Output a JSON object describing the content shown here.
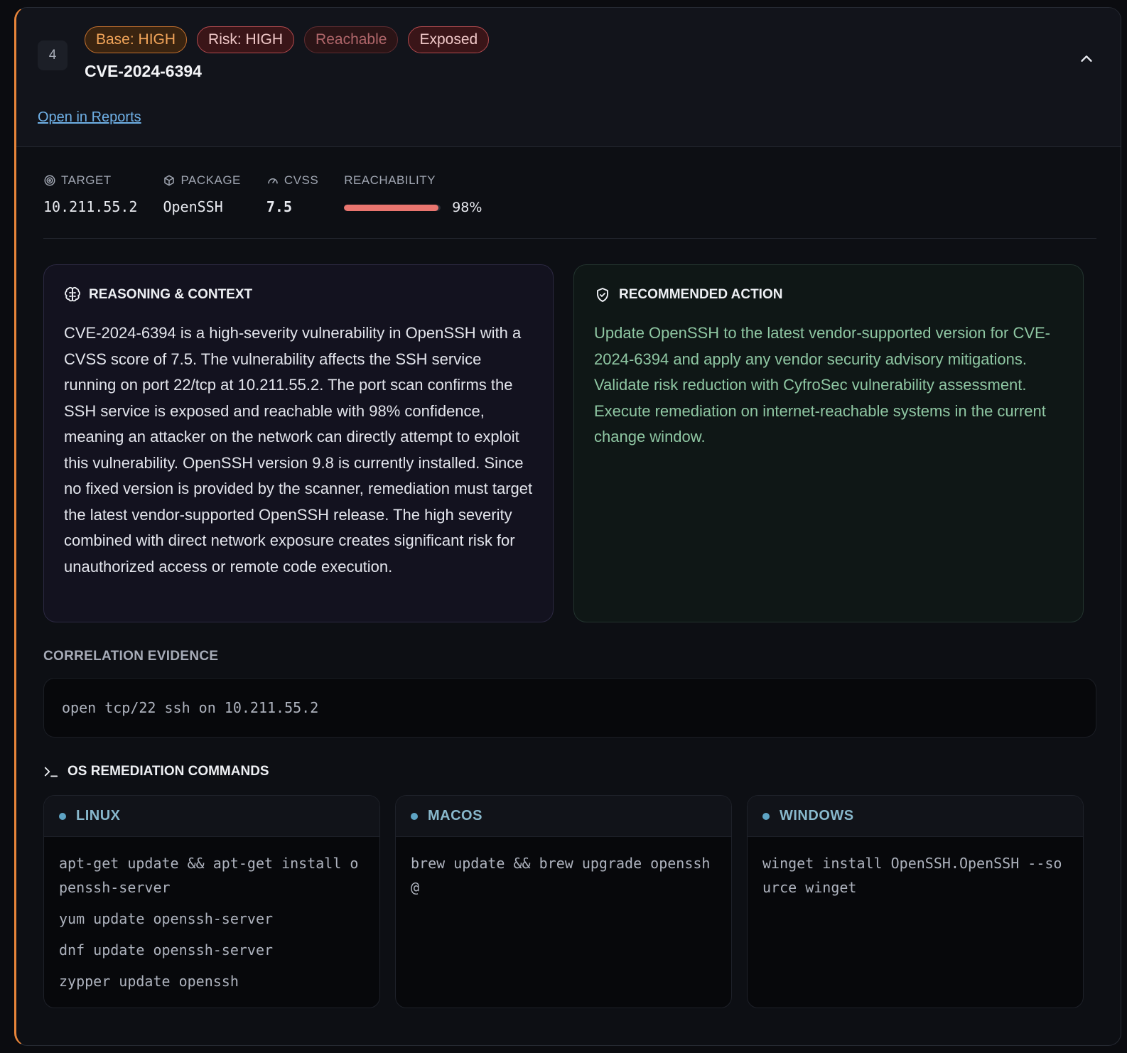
{
  "finding": {
    "index": "4",
    "badges": {
      "base": "Base: HIGH",
      "risk": "Risk: HIGH",
      "reachable": "Reachable",
      "exposed": "Exposed"
    },
    "cve_id": "CVE-2024-6394",
    "open_link": "Open in Reports",
    "accent_color": "#e8853a"
  },
  "meta": {
    "target_label": "TARGET",
    "target_value": "10.211.55.2",
    "package_label": "PACKAGE",
    "package_value": "OpenSSH",
    "cvss_label": "CVSS",
    "cvss_value": "7.5",
    "reachability_label": "REACHABILITY",
    "reachability_pct": "98%",
    "reachability_fraction": 0.98
  },
  "reasoning": {
    "title": "REASONING & CONTEXT",
    "body": "CVE-2024-6394 is a high-severity vulnerability in OpenSSH with a CVSS score of 7.5. The vulnerability affects the SSH service running on port 22/tcp at 10.211.55.2. The port scan confirms the SSH service is exposed and reachable with 98% confidence, meaning an attacker on the network can directly attempt to exploit this vulnerability. OpenSSH version 9.8 is currently installed. Since no fixed version is provided by the scanner, remediation must target the latest vendor-supported OpenSSH release. The high severity combined with direct network exposure creates significant risk for unauthorized access or remote code execution."
  },
  "action": {
    "title": "RECOMMENDED ACTION",
    "body": "Update OpenSSH to the latest vendor-supported version for CVE-2024-6394 and apply any vendor security advisory mitigations. Validate risk reduction with CyfroSec vulnerability assessment. Execute remediation on internet-reachable systems in the current change window."
  },
  "evidence": {
    "label": "CORRELATION EVIDENCE",
    "text": "open tcp/22 ssh on 10.211.55.2"
  },
  "commands": {
    "title": "OS REMEDIATION COMMANDS",
    "linux": {
      "label": "LINUX",
      "cmds": [
        "apt-get update && apt-get install openssh-server",
        "yum update openssh-server",
        "dnf update openssh-server",
        "zypper update openssh"
      ]
    },
    "macos": {
      "label": "MACOS",
      "cmds": [
        "brew update && brew upgrade openssh@"
      ]
    },
    "windows": {
      "label": "WINDOWS",
      "cmds": [
        "winget install OpenSSH.OpenSSH --source winget"
      ]
    }
  }
}
